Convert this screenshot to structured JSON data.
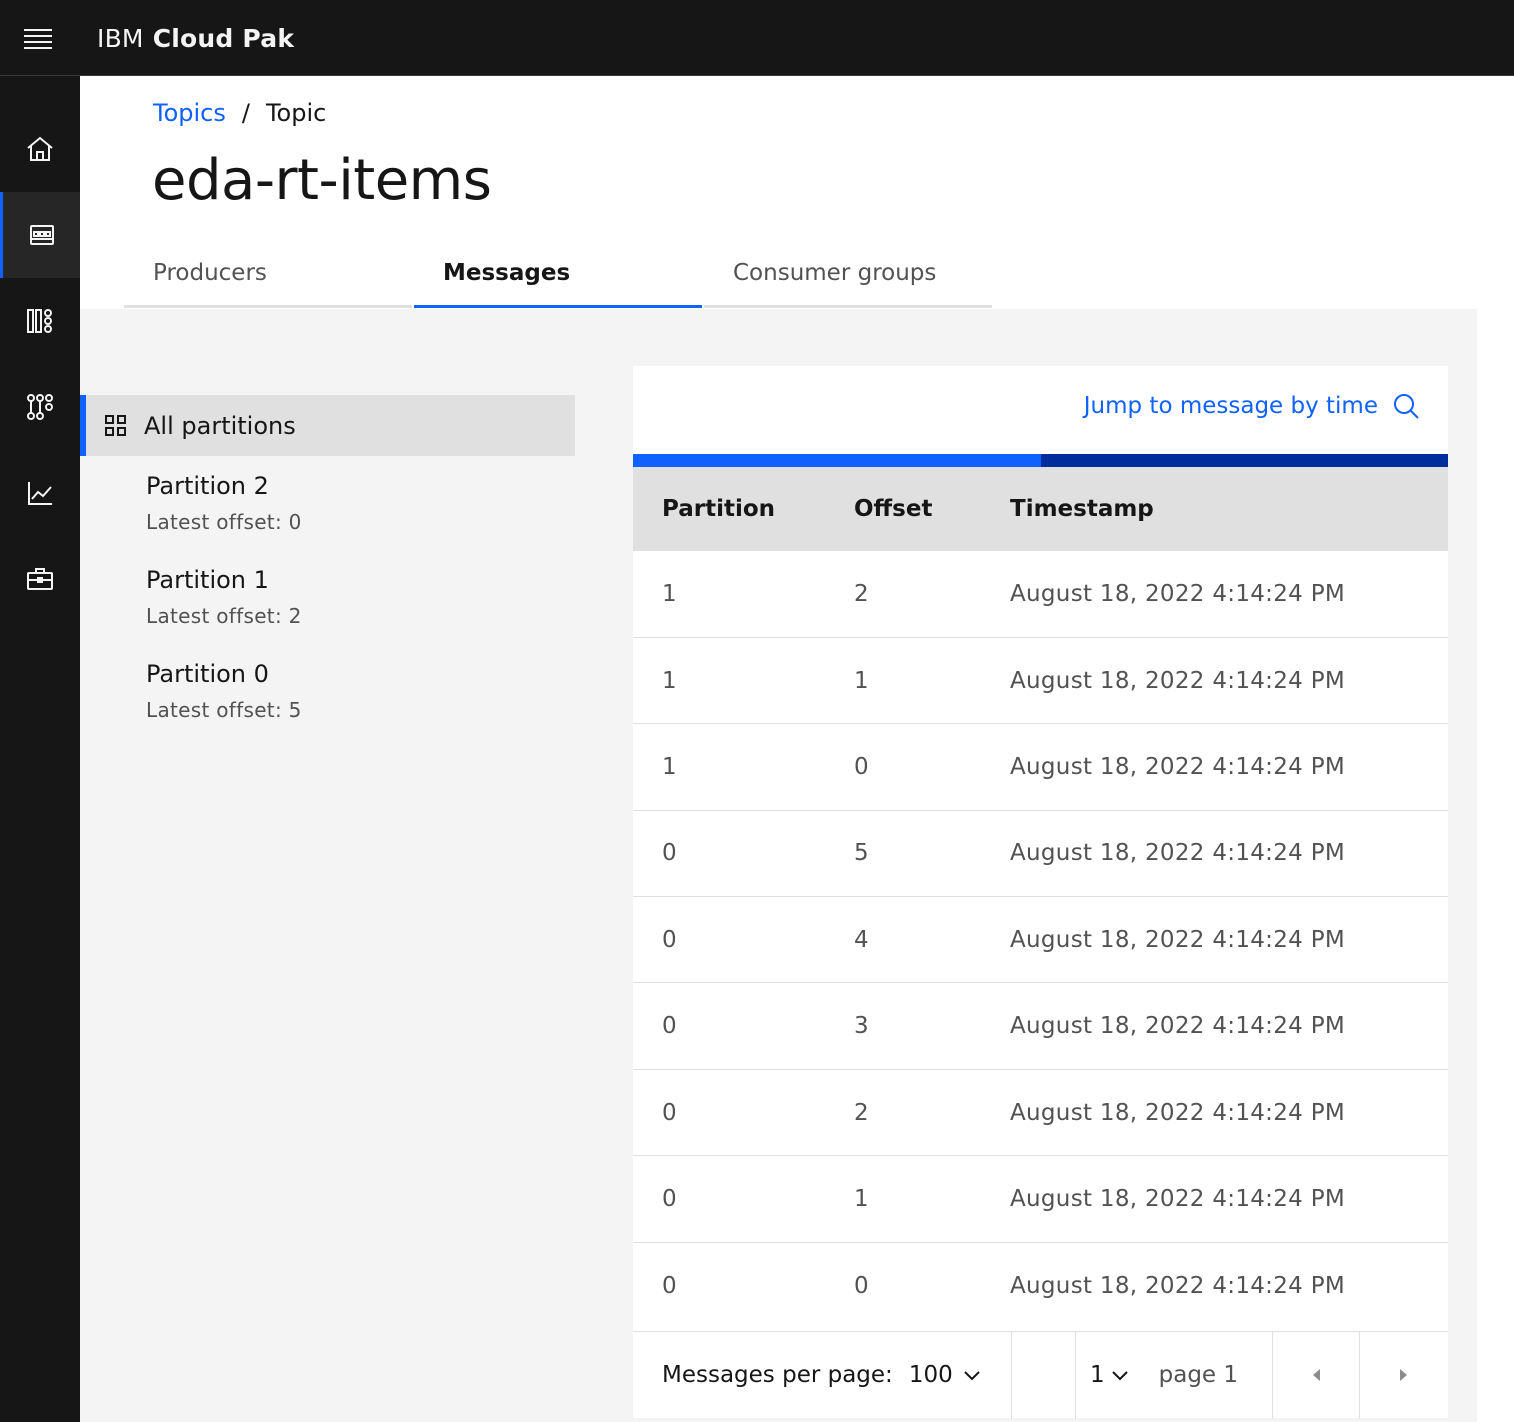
{
  "header": {
    "brand_prefix": "IBM",
    "brand_name": "Cloud Pak"
  },
  "rail": {
    "items": [
      {
        "icon": "home-icon"
      },
      {
        "icon": "topics-icon",
        "active": true
      },
      {
        "icon": "schema-icon"
      },
      {
        "icon": "consumer-groups-icon"
      },
      {
        "icon": "monitoring-icon"
      },
      {
        "icon": "toolbox-icon"
      }
    ]
  },
  "breadcrumb": {
    "link": "Topics",
    "separator": "/",
    "current": "Topic"
  },
  "page": {
    "title": "eda-rt-items"
  },
  "tabs": [
    {
      "label": "Producers",
      "active": false
    },
    {
      "label": "Messages",
      "active": true
    },
    {
      "label": "Consumer groups",
      "active": false
    }
  ],
  "partitions": {
    "all_label": "All partitions",
    "items": [
      {
        "name": "Partition 2",
        "offset": "Latest offset: 0"
      },
      {
        "name": "Partition 1",
        "offset": "Latest offset: 2"
      },
      {
        "name": "Partition 0",
        "offset": "Latest offset: 5"
      }
    ]
  },
  "messages": {
    "jump_label": "Jump to message by time",
    "progress": 0.5,
    "columns": [
      "Partition",
      "Offset",
      "Timestamp"
    ],
    "rows": [
      [
        "1",
        "2",
        "August 18, 2022 4:14:24 PM"
      ],
      [
        "1",
        "1",
        "August 18, 2022 4:14:24 PM"
      ],
      [
        "1",
        "0",
        "August 18, 2022 4:14:24 PM"
      ],
      [
        "0",
        "5",
        "August 18, 2022 4:14:24 PM"
      ],
      [
        "0",
        "4",
        "August 18, 2022 4:14:24 PM"
      ],
      [
        "0",
        "3",
        "August 18, 2022 4:14:24 PM"
      ],
      [
        "0",
        "2",
        "August 18, 2022 4:14:24 PM"
      ],
      [
        "0",
        "1",
        "August 18, 2022 4:14:24 PM"
      ],
      [
        "0",
        "0",
        "August 18, 2022 4:14:24 PM"
      ]
    ]
  },
  "pagination": {
    "per_page_label": "Messages per page:",
    "per_page_value": "100",
    "page_number": "1",
    "page_text": "page 1"
  },
  "colors": {
    "accent": "#0f62fe",
    "header_bg": "#161616",
    "content_bg": "#f4f4f4"
  }
}
